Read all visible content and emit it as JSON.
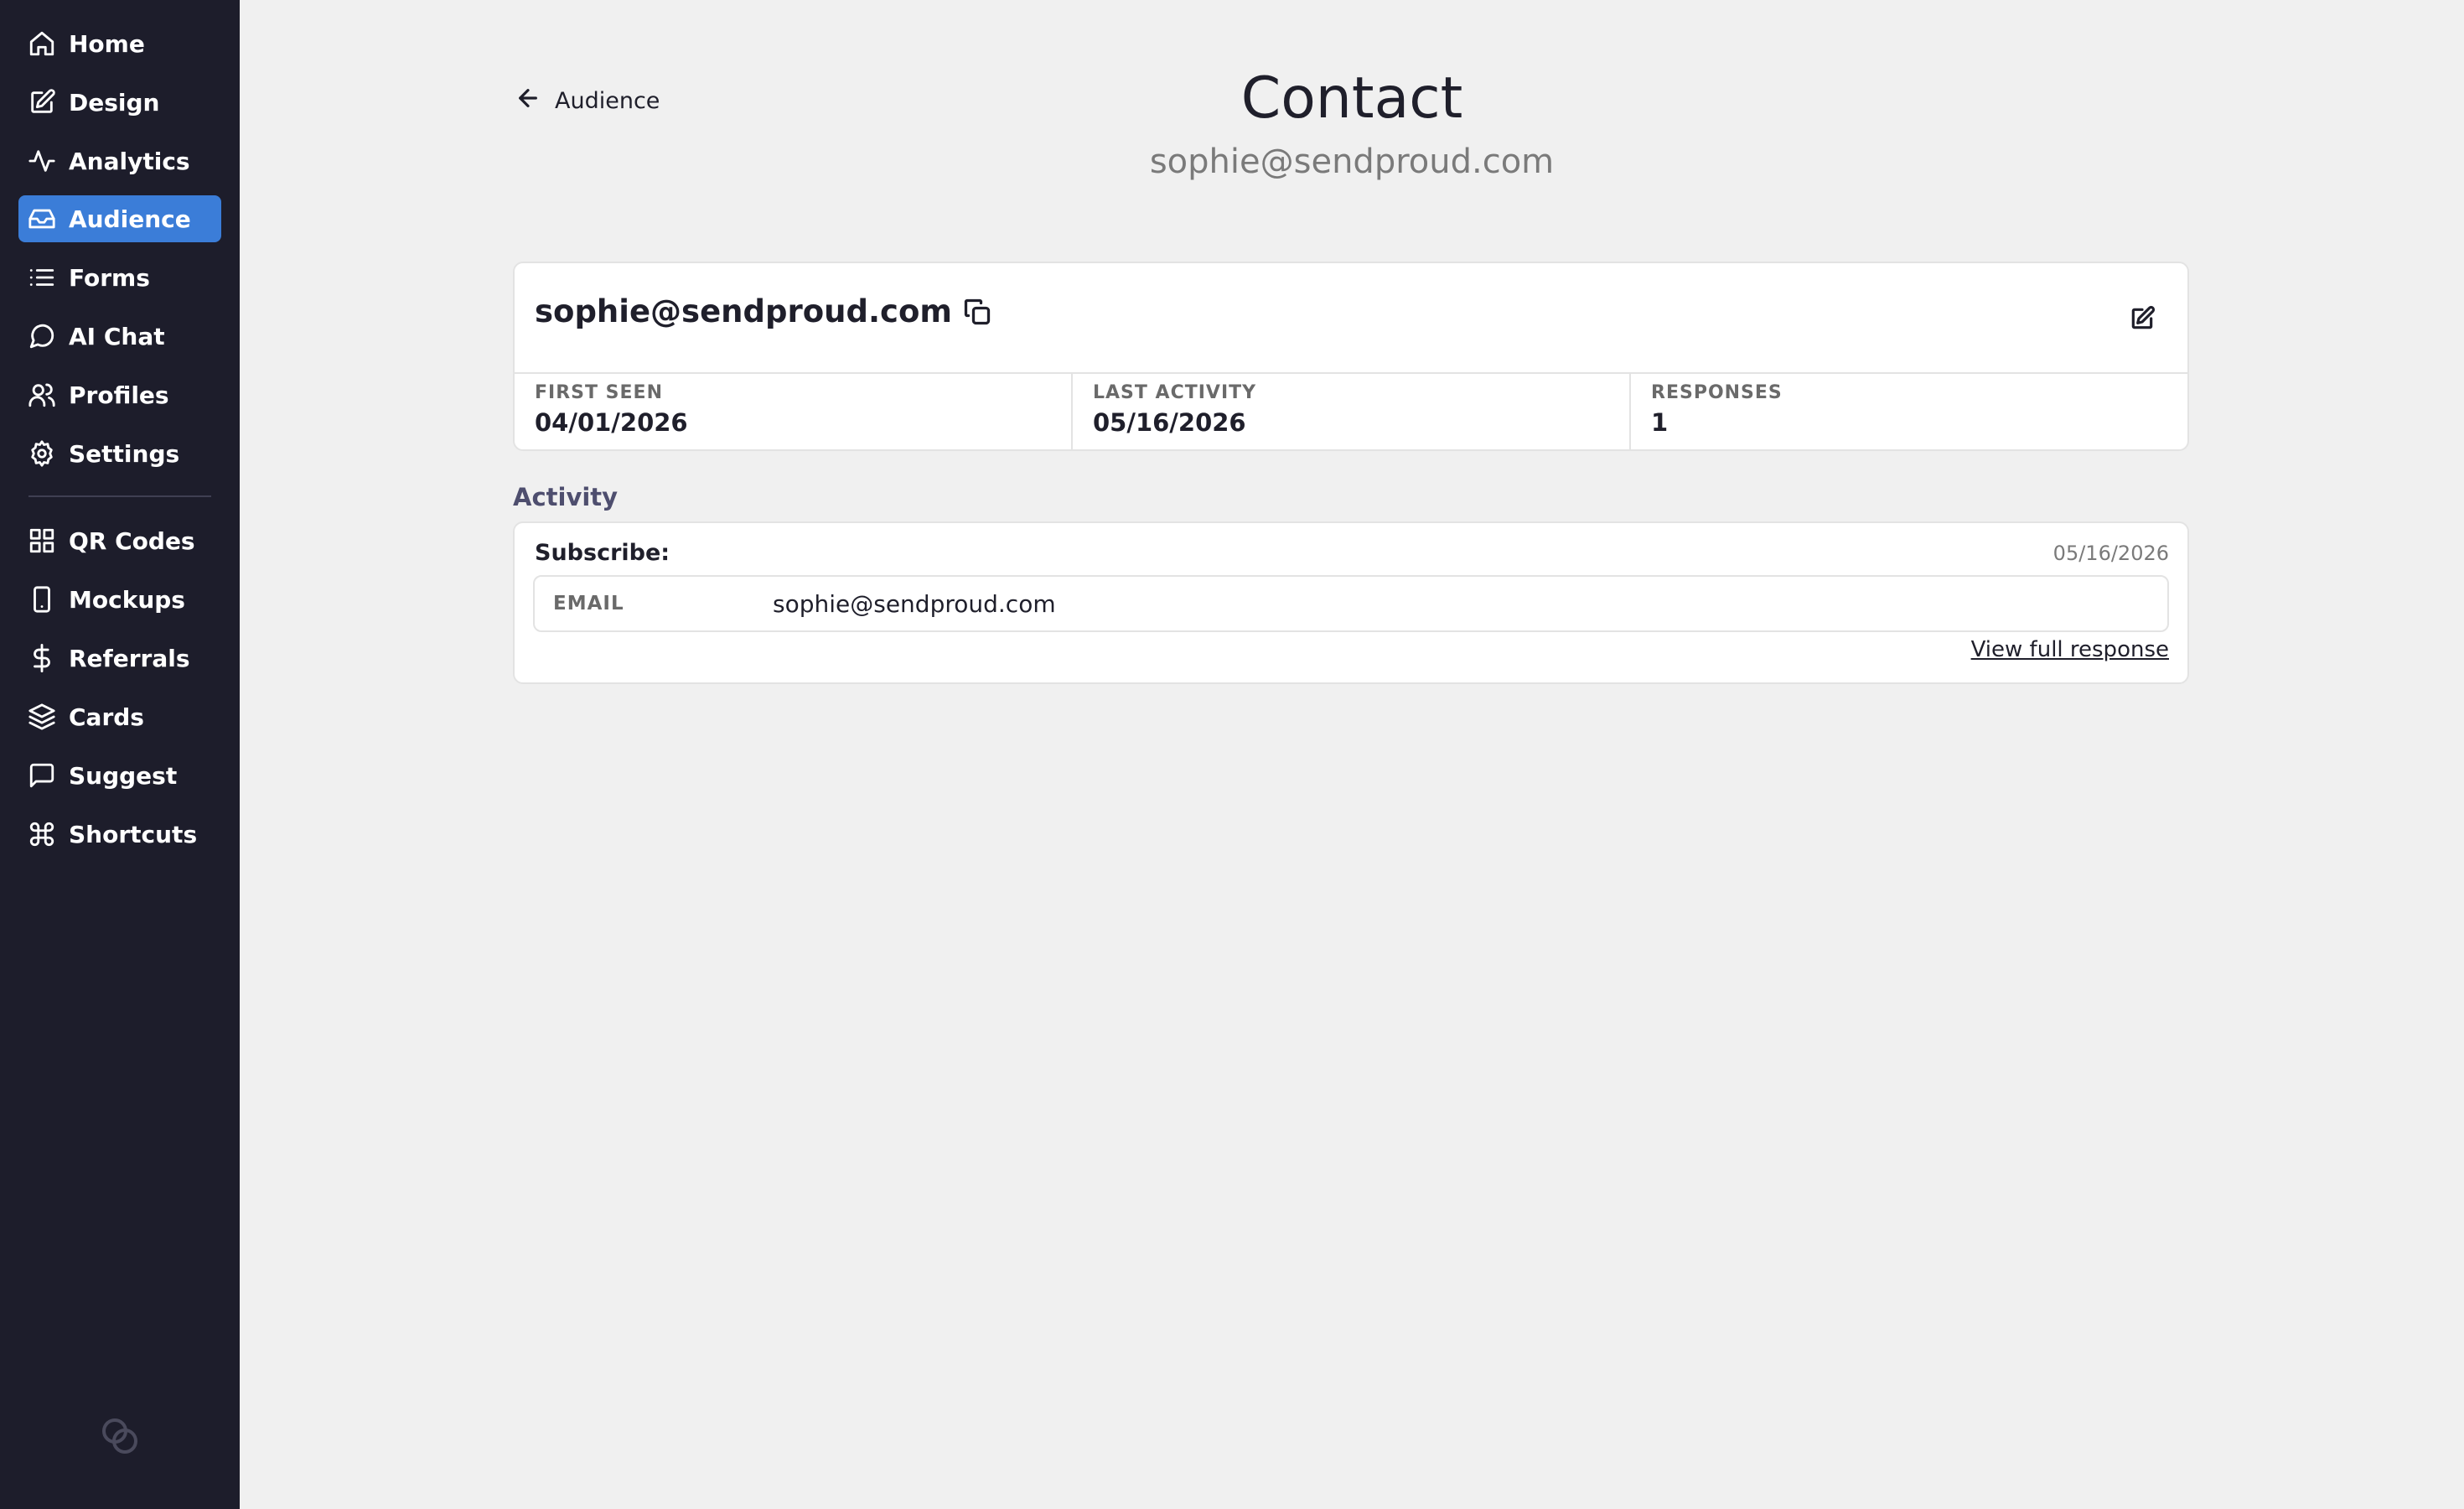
{
  "sidebar": {
    "items": [
      {
        "label": "Home",
        "icon": "home-icon"
      },
      {
        "label": "Design",
        "icon": "edit-icon"
      },
      {
        "label": "Analytics",
        "icon": "activity-icon"
      },
      {
        "label": "Audience",
        "icon": "inbox-icon",
        "active": true
      },
      {
        "label": "Forms",
        "icon": "list-icon"
      },
      {
        "label": "AI Chat",
        "icon": "chat-bubble-icon"
      },
      {
        "label": "Profiles",
        "icon": "users-icon"
      },
      {
        "label": "Settings",
        "icon": "gear-icon"
      },
      {
        "label": "QR Codes",
        "icon": "grid-icon"
      },
      {
        "label": "Mockups",
        "icon": "phone-icon"
      },
      {
        "label": "Referrals",
        "icon": "dollar-icon"
      },
      {
        "label": "Cards",
        "icon": "layers-icon"
      },
      {
        "label": "Suggest",
        "icon": "message-square-icon"
      },
      {
        "label": "Shortcuts",
        "icon": "command-icon"
      }
    ],
    "accent_color": "#3b7dd8",
    "background_color": "#1d1d2b"
  },
  "header": {
    "back_label": "Audience",
    "title": "Contact",
    "subtitle": "sophie@sendproud.com"
  },
  "contact": {
    "email": "sophie@sendproud.com",
    "stats": [
      {
        "label": "FIRST SEEN",
        "value": "04/01/2026"
      },
      {
        "label": "LAST ACTIVITY",
        "value": "05/16/2026"
      },
      {
        "label": "RESPONSES",
        "value": "1"
      }
    ]
  },
  "activity": {
    "heading": "Activity",
    "entries": [
      {
        "type": "Subscribe:",
        "date": "05/16/2026",
        "field_label": "EMAIL",
        "field_value": "sophie@sendproud.com",
        "link_label": "View full response"
      }
    ]
  }
}
